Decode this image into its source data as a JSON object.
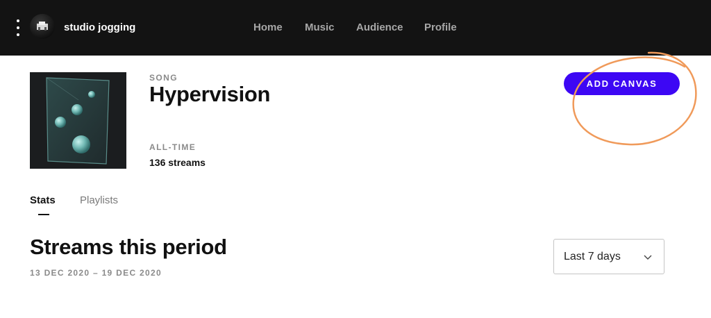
{
  "header": {
    "artist_name": "studio jogging",
    "nav": [
      "Home",
      "Music",
      "Audience",
      "Profile"
    ]
  },
  "song": {
    "kicker": "SONG",
    "title": "Hypervision",
    "alltime_kicker": "ALL-TIME",
    "alltime_value": "136 streams",
    "add_canvas_label": "ADD CANVAS"
  },
  "tabs": [
    "Stats",
    "Playlists"
  ],
  "stats": {
    "title": "Streams this period",
    "date_range": "13 DEC 2020 – 19 DEC 2020",
    "period_selected": "Last 7 days"
  },
  "colors": {
    "topbar": "#131313",
    "accent": "#3d07f4",
    "annotation": "#f09a5a"
  }
}
